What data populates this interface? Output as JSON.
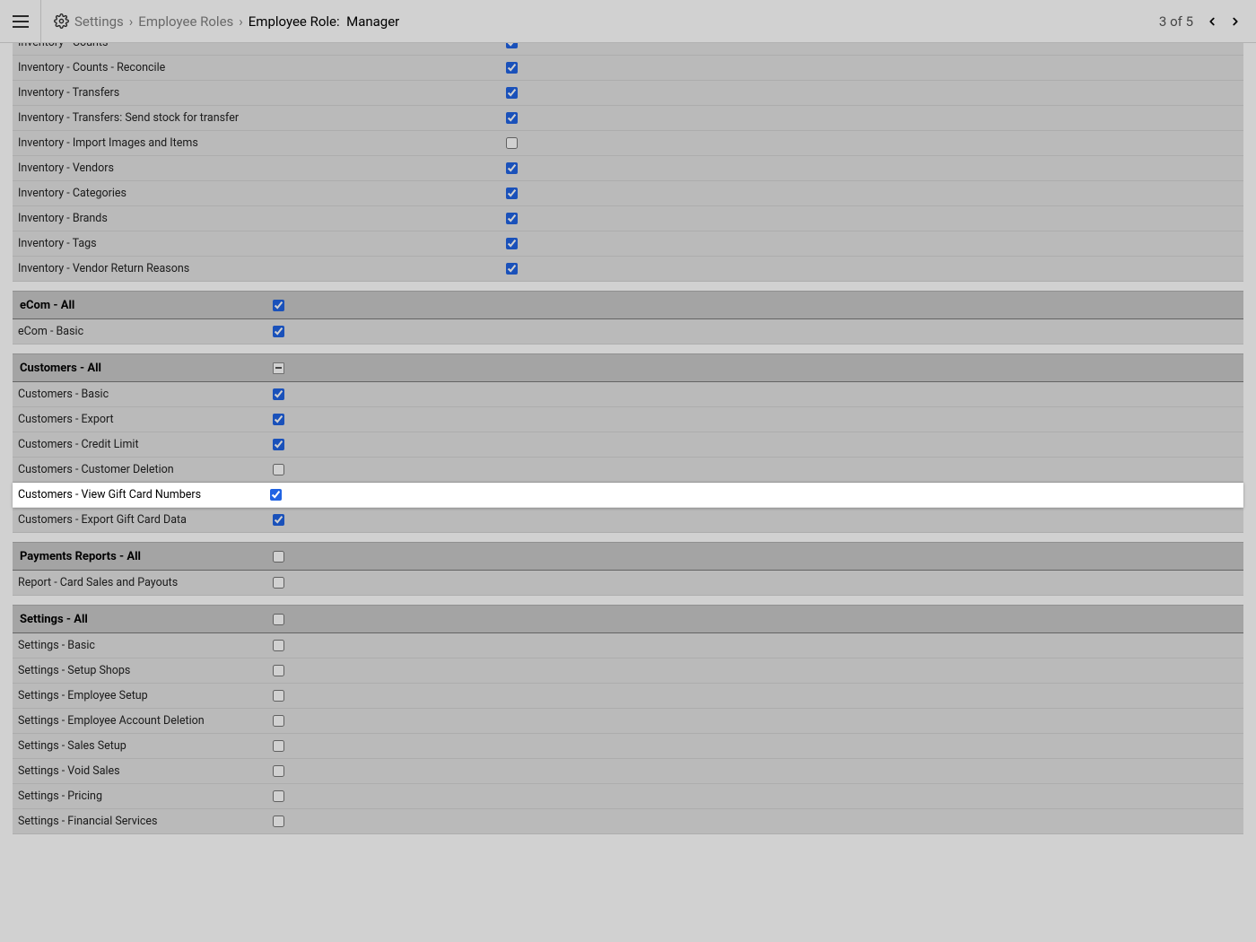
{
  "header": {
    "breadcrumb": [
      "Settings",
      "Employee Roles"
    ],
    "title_prefix": "Employee Role:",
    "title_value": "Manager",
    "pager": "3 of 5"
  },
  "inventory_rows": [
    {
      "label": "Inventory - Counts",
      "checked": true
    },
    {
      "label": "Inventory - Counts - Reconcile",
      "checked": true
    },
    {
      "label": "Inventory - Transfers",
      "checked": true
    },
    {
      "label": "Inventory - Transfers: Send stock for transfer",
      "checked": true
    },
    {
      "label": "Inventory - Import Images and Items",
      "checked": false
    },
    {
      "label": "Inventory - Vendors",
      "checked": true
    },
    {
      "label": "Inventory - Categories",
      "checked": true
    },
    {
      "label": "Inventory - Brands",
      "checked": true
    },
    {
      "label": "Inventory - Tags",
      "checked": true
    },
    {
      "label": "Inventory - Vendor Return Reasons",
      "checked": true
    }
  ],
  "sections": [
    {
      "title": "eCom - All",
      "state": "checked",
      "rows": [
        {
          "label": "eCom - Basic",
          "checked": true
        }
      ]
    },
    {
      "title": "Customers - All",
      "state": "indeterminate",
      "rows": [
        {
          "label": "Customers - Basic",
          "checked": true
        },
        {
          "label": "Customers - Export",
          "checked": true
        },
        {
          "label": "Customers - Credit Limit",
          "checked": true
        },
        {
          "label": "Customers - Customer Deletion",
          "checked": false
        },
        {
          "label": "Customers - View Gift Card Numbers",
          "checked": true,
          "highlight": true
        },
        {
          "label": "Customers - Export Gift Card Data",
          "checked": true
        }
      ]
    },
    {
      "title": "Payments Reports - All",
      "state": "unchecked",
      "rows": [
        {
          "label": "Report - Card Sales and Payouts",
          "checked": false
        }
      ]
    },
    {
      "title": "Settings - All",
      "state": "unchecked",
      "rows": [
        {
          "label": "Settings - Basic",
          "checked": false
        },
        {
          "label": "Settings - Setup Shops",
          "checked": false
        },
        {
          "label": "Settings - Employee Setup",
          "checked": false
        },
        {
          "label": "Settings - Employee Account Deletion",
          "checked": false
        },
        {
          "label": "Settings - Sales Setup",
          "checked": false
        },
        {
          "label": "Settings - Void Sales",
          "checked": false
        },
        {
          "label": "Settings - Pricing",
          "checked": false
        },
        {
          "label": "Settings - Financial Services",
          "checked": false
        }
      ]
    }
  ]
}
